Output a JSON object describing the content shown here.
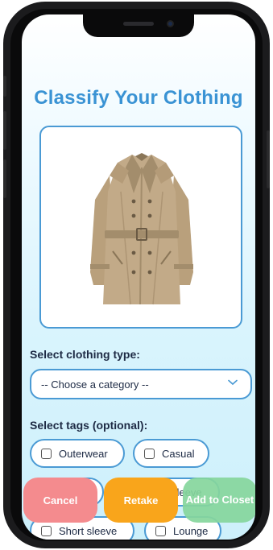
{
  "screen": {
    "title": "Classify Your Clothing"
  },
  "clothing_image": {
    "subject": "trench-coat-photo",
    "colors": {
      "coat": "#c2aa88",
      "shadow": "#a38d6c",
      "button": "#6a5a44"
    }
  },
  "type_section": {
    "label": "Select clothing type:",
    "select_value": "-- Choose a category --"
  },
  "tags_section": {
    "label": "Select tags (optional):",
    "tags": [
      {
        "label": "Outerwear",
        "checked": false
      },
      {
        "label": "Casual",
        "checked": false
      },
      {
        "label": "",
        "checked": false
      },
      {
        "label": "sleeve",
        "checked": false
      },
      {
        "label": "Short sleeve",
        "checked": false
      },
      {
        "label": "Lounge",
        "checked": false
      }
    ]
  },
  "actions": {
    "cancel_label": "Cancel",
    "retake_label": "Retake",
    "add_label": "Add to Closet"
  },
  "theme": {
    "accent": "#3a93d4",
    "border": "#4a9ad4",
    "cancel": "#f48b8e",
    "retake": "#f9a51b",
    "add": "#85d69c"
  }
}
